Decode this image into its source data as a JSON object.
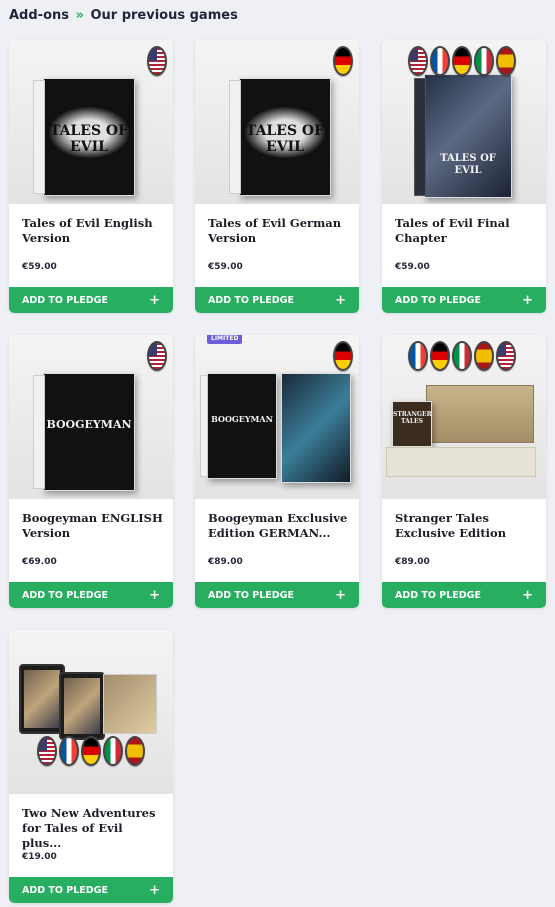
{
  "breadcrumb": {
    "parent": "Add-ons",
    "separator": "»",
    "current": "Our previous games"
  },
  "colors": {
    "accent": "#27ae60",
    "limited_badge": "#6b5fd8",
    "background": "#eef0f6"
  },
  "products": [
    {
      "title": "Tales of Evil English Version",
      "price": "€59.00",
      "button_label": "ADD TO PLEDGE",
      "button_icon": "plus-icon",
      "flags": [
        "us"
      ],
      "box_art": "TALES OF EVIL"
    },
    {
      "title": "Tales of Evil German Version",
      "price": "€59.00",
      "button_label": "ADD TO PLEDGE",
      "button_icon": "plus-icon",
      "flags": [
        "de"
      ],
      "box_art": "TALES OF EVIL"
    },
    {
      "title": "Tales of Evil Final Chapter",
      "price": "€59.00",
      "button_label": "ADD TO PLEDGE",
      "button_icon": "plus-icon",
      "flags": [
        "us",
        "fr",
        "de",
        "it",
        "es"
      ],
      "box_art": "TALES OF EVIL"
    },
    {
      "title": "Boogeyman ENGLISH Version",
      "price": "€69.00",
      "button_label": "ADD TO PLEDGE",
      "button_icon": "plus-icon",
      "flags": [
        "us"
      ],
      "box_art": "BOOGEYMAN"
    },
    {
      "title": "Boogeyman Exclusive Edition GERMAN...",
      "price": "€89.00",
      "button_label": "ADD TO PLEDGE",
      "button_icon": "plus-icon",
      "flags": [
        "de"
      ],
      "badge": "LIMITED",
      "box_art": "BOOGEYMAN"
    },
    {
      "title": "Stranger Tales Exclusive Edition",
      "price": "€89.00",
      "button_label": "ADD TO PLEDGE",
      "button_icon": "plus-icon",
      "flags": [
        "fr",
        "de",
        "it",
        "es",
        "us"
      ],
      "box_art": "STRANGER TALES"
    },
    {
      "title": "Two New Adventures for Tales of Evil plus...",
      "price": "€19.00",
      "button_label": "ADD TO PLEDGE",
      "button_icon": "plus-icon",
      "flags": [
        "us",
        "fr",
        "de",
        "it",
        "es"
      ]
    }
  ]
}
